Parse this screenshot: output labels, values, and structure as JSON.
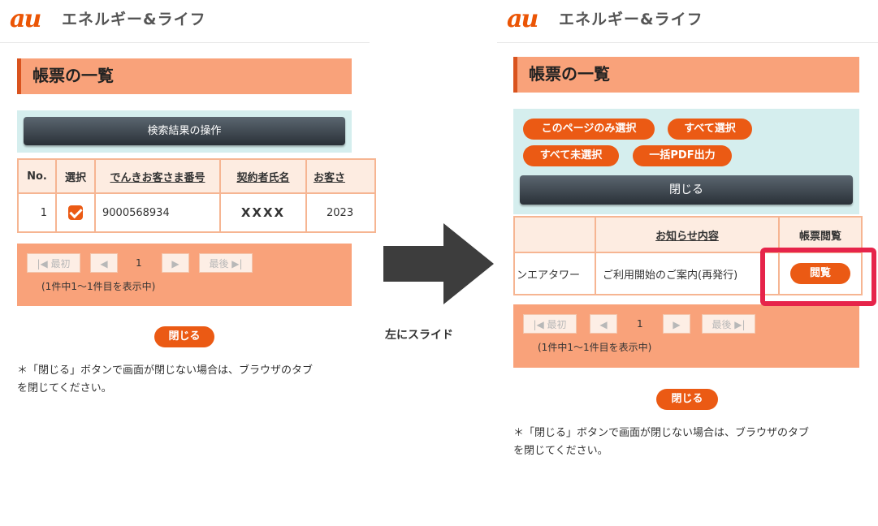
{
  "brand": {
    "logo": "au",
    "name": "エネルギー&ライフ"
  },
  "page_title": "帳票の一覧",
  "left": {
    "op_button": "検索結果の操作",
    "table": {
      "headers": [
        "No.",
        "選択",
        "でんきお客さま番号",
        "契約者氏名",
        "お客さ"
      ],
      "row": {
        "no": "1",
        "customer_number": "9000568934",
        "contract_name": "XXXX",
        "partial": "2023"
      }
    }
  },
  "right": {
    "actions": [
      "このページのみ選択",
      "すべて選択",
      "すべて未選択",
      "一括PDF出力"
    ],
    "close_ops": "閉じる",
    "table": {
      "headers": [
        "お知らせ内容",
        "帳票閲覧"
      ],
      "row": {
        "partial": "ンエアタワー",
        "notice": "ご利用開始のご案内(再発行)",
        "view": "閲覧"
      }
    }
  },
  "pager": {
    "first": "最初",
    "last": "最後",
    "page": "1",
    "status": "(1件中1〜1件目を表示中)"
  },
  "close_button": "閉じる",
  "note": {
    "line1": "＊「閉じる」ボタンで画面が閉じない場合は、ブラウザのタブ",
    "line2": "を閉じてください。"
  },
  "slide_caption": "左にスライド",
  "colors": {
    "accent": "#eb5a14",
    "title_bg": "#f9a27a",
    "op_bg": "#d5eeee",
    "highlight": "#e6244a"
  }
}
